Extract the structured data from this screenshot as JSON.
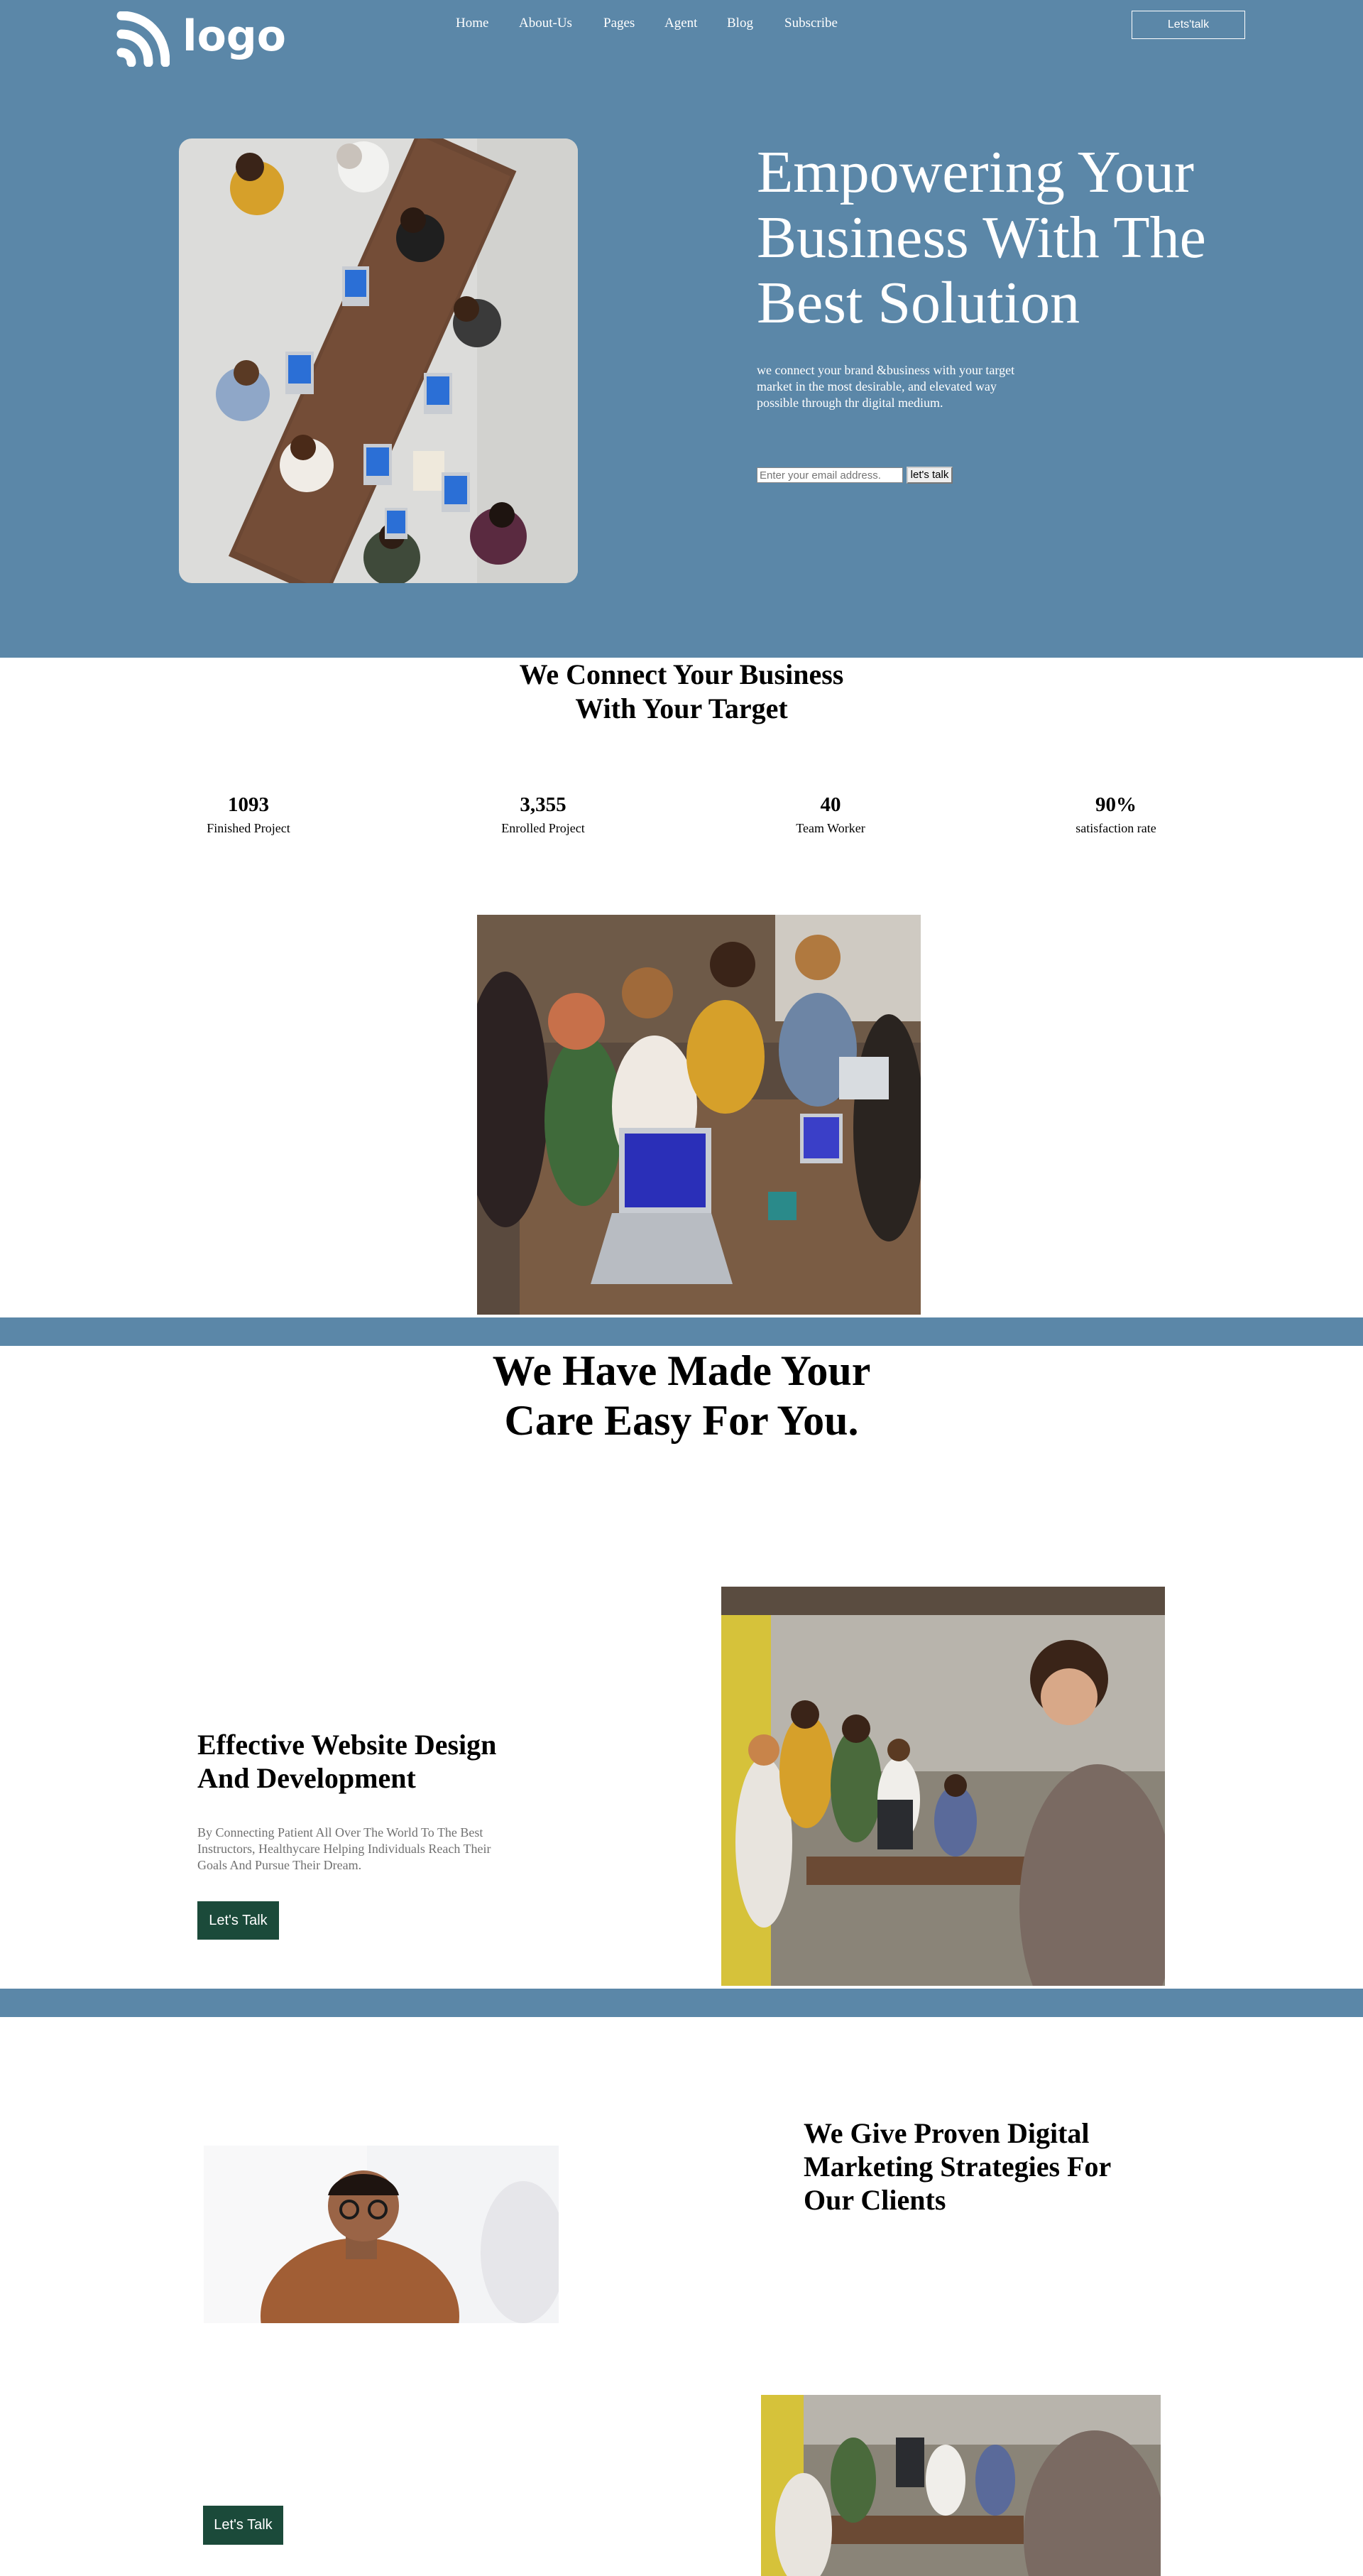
{
  "header": {
    "logo_text": "logo",
    "nav": [
      "Home",
      "About-Us",
      "Pages",
      "Agent",
      "Blog",
      "Subscribe"
    ],
    "cta_label": "Lets'talk"
  },
  "hero": {
    "title_lines": [
      "Empowering Your",
      "Business With The",
      "Best Solution"
    ],
    "description_lines": [
      "we connect your brand &business with your target",
      "market in the most desirable, and elevated way",
      "possible through thr digital medium."
    ],
    "email_placeholder": "Enter your email address.",
    "submit_label": "let's talk"
  },
  "connect": {
    "title_lines": [
      "We Connect Your Business",
      "With Your Target"
    ],
    "stats": [
      {
        "value": "1093",
        "label": "Finished Project"
      },
      {
        "value": "3,355",
        "label": "Enrolled Project"
      },
      {
        "value": "40",
        "label": "Team Worker"
      },
      {
        "value": "90%",
        "label": "satisfaction rate"
      }
    ]
  },
  "care": {
    "title_lines": [
      "We Have Made Your",
      "Care Easy For You."
    ]
  },
  "feature": {
    "title_lines": [
      "Effective Website Design",
      "And Development"
    ],
    "description_lines": [
      "By Connecting Patient All Over The World To The Best",
      "Instructors, Healthycare Helping Individuals Reach Their",
      "Goals And Pursue Their Dream."
    ],
    "button_label": "Let's Talk"
  },
  "marketing": {
    "title_lines": [
      "We Give Proven Digital",
      "Marketing Strategies For",
      "Our Clients"
    ],
    "button_label": "Let's Talk"
  },
  "colors": {
    "brand_blue": "#5b87a8",
    "button_green": "#1b4a3a"
  }
}
